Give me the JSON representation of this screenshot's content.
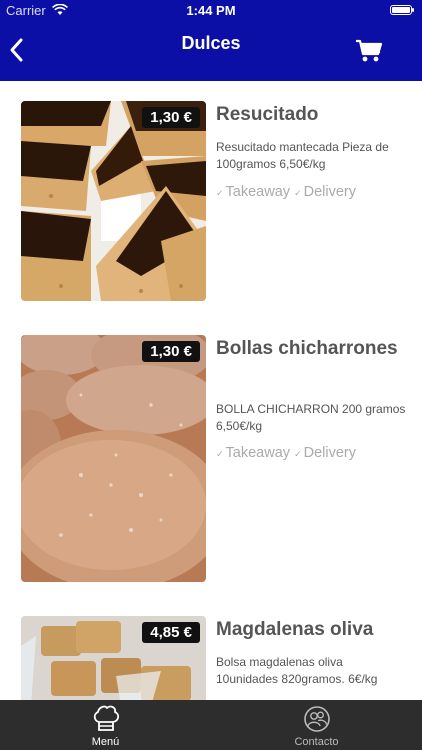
{
  "status_bar": {
    "carrier": "Carrier",
    "time": "1:44 PM"
  },
  "nav": {
    "title": "Dulces"
  },
  "products": [
    {
      "name": "Resucitado",
      "price": "1,30 €",
      "description": "Resucitado mantecada Pieza de 100gramos 6,50€/kg",
      "options": [
        "Takeaway",
        "Delivery"
      ]
    },
    {
      "name": "Bollas chicharrones",
      "price": "1,30 €",
      "description": "BOLLA CHICHARRON 200 gramos 6,50€/kg",
      "options": [
        "Takeaway",
        "Delivery"
      ]
    },
    {
      "name": "Magdalenas oliva",
      "price": "4,85 €",
      "description": "Bolsa magdalenas oliva 10unidades 820gramos. 6€/kg",
      "options": []
    }
  ],
  "tabbar": {
    "tabs": [
      {
        "label": "Menú",
        "icon": "chef-hat-icon",
        "active": true
      },
      {
        "label": "Contacto",
        "icon": "contact-icon",
        "active": false
      }
    ]
  },
  "colors": {
    "header": "#0b0fa6",
    "tabbar": "#2d2d2d",
    "badge": "#111111",
    "text": "#555555"
  }
}
